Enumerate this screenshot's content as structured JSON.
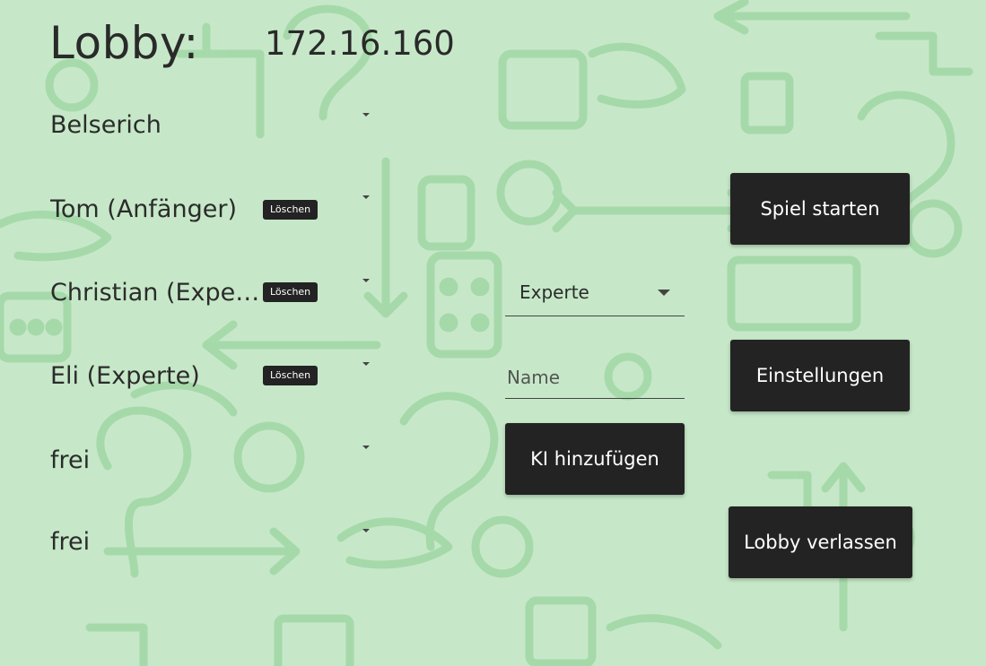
{
  "header": {
    "title": "Lobby:",
    "ip": "172.16.160"
  },
  "players": [
    {
      "name": "Belserich",
      "delete_label": ""
    },
    {
      "name": "Tom (Anfänger)",
      "delete_label": "Löschen"
    },
    {
      "name": "Christian (Experte)",
      "delete_label": "Löschen"
    },
    {
      "name": "Eli (Experte)",
      "delete_label": "Löschen"
    },
    {
      "name": "frei",
      "delete_label": ""
    },
    {
      "name": "frei",
      "delete_label": ""
    }
  ],
  "ai": {
    "difficulty_value": "Experte",
    "name_placeholder": "Name",
    "add_button": "KI hinzufügen"
  },
  "buttons": {
    "start": "Spiel starten",
    "settings": "Einstellungen",
    "leave": "Lobby verlassen"
  },
  "icons": {
    "slot_dropdown": "caret-down-icon",
    "select_dropdown": "triangle-down-icon"
  },
  "colors": {
    "background": "#c6e8c8",
    "pattern": "#9fd6a3",
    "button": "#232323",
    "button_text": "#ffffff"
  }
}
